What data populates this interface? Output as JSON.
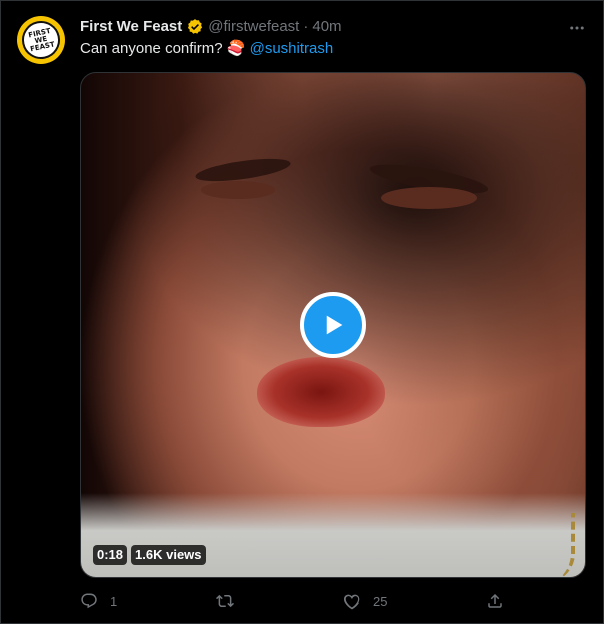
{
  "author": {
    "name": "First We Feast",
    "handle": "@firstwefeast",
    "separator": "·",
    "time": "40m",
    "avatar_text": [
      "FIRST",
      "WE",
      "FEAST"
    ]
  },
  "tweet": {
    "text": "Can anyone confirm? ",
    "emoji": "🍣",
    "mention": "@sushitrash"
  },
  "video": {
    "duration": "0:18",
    "views": "1.6K views"
  },
  "actions": {
    "replies": "1",
    "retweets": "",
    "likes": "25"
  },
  "colors": {
    "accent": "#1d9bf0",
    "verified": "#f6c400",
    "muted": "#71767b",
    "background": "#000000"
  },
  "icons": [
    "verified-badge-icon",
    "more-icon",
    "play-icon",
    "reply-icon",
    "retweet-icon",
    "like-icon",
    "share-icon"
  ]
}
